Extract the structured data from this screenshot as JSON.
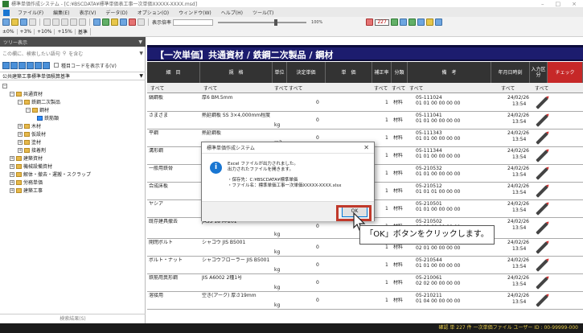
{
  "window": {
    "title": "標準単価作成システム - [C:¥BSCDATA¥標準単価表工事一次単価XXXXX-XXXX.msd]",
    "controls": [
      "–",
      "□",
      "×"
    ]
  },
  "menu": [
    "ファイル(F)",
    "編集(E)",
    "表示(V)",
    "データ(D)",
    "オプション(O)",
    "ウィンドウ(W)",
    "ヘルプ(H)",
    "ツール(T)"
  ],
  "toolbar": {
    "mode_label": "表示倍率",
    "zoom_label": "100%",
    "page_number": "227",
    "percent_buttons": [
      "±0%",
      "+3%",
      "+10%",
      "+15%",
      "基準"
    ]
  },
  "tree": {
    "header": "ツリー表示",
    "search_placeholder": "この欄に、検索したい語句",
    "search_mode": "を含む",
    "code_checkbox_label": "種目コードを表示する(V)",
    "root_title": "公共建築工事標準単価積算基準",
    "nodes": [
      {
        "label": "共通資材",
        "toggle": "⊟"
      },
      {
        "label": "鉄鋼二次製品",
        "toggle": "⊟"
      },
      {
        "label": "鋼材",
        "toggle": "⊟"
      },
      {
        "label": "鉄筋類",
        "toggle": ""
      },
      {
        "label": "木材",
        "toggle": "⊞"
      },
      {
        "label": "仮設材",
        "toggle": "⊞"
      },
      {
        "label": "塗材",
        "toggle": "⊞"
      },
      {
        "label": "接着剤",
        "toggle": "⊞"
      },
      {
        "label": "建築資材",
        "toggle": "⊞"
      },
      {
        "label": "機械設備資材",
        "toggle": "⊞"
      },
      {
        "label": "解体・撤去・運搬・スクラップ",
        "toggle": "⊞"
      },
      {
        "label": "労務単価",
        "toggle": "⊞"
      },
      {
        "label": "建築工事",
        "toggle": "⊞"
      }
    ],
    "bottom_search": "検索結果(S)"
  },
  "main": {
    "banner": "【一次単価】共通資材 / 鉄鋼二次製品 / 鋼材",
    "columns": [
      "細　目",
      "規　格",
      "単位",
      "決定単価",
      "単　価",
      "補正率",
      "分類",
      "備　考",
      "年月日時刻",
      "入力区分",
      "チェック"
    ],
    "filters": [
      "すべて",
      "すべて",
      "すべて",
      "すべて",
      "すべて",
      "すべて",
      "すべて",
      "すべて",
      "すべて"
    ],
    "rows": [
      {
        "name": "縞鋼板",
        "spec": "厚6 BM.5mm",
        "unit": "",
        "price": "0",
        "rate": "1",
        "cls": "材料",
        "code1": "05-111024",
        "code2": "01 01 00 00 00 00",
        "date": "24/02/26",
        "time": "13:54"
      },
      {
        "name": "さまざま",
        "spec": "熱延鋼板 SS 3×4,000mm程度",
        "unit": "kg",
        "price": "0",
        "rate": "1",
        "cls": "材料",
        "code1": "05-111041",
        "code2": "01 01 00 00 00 00",
        "date": "24/02/26",
        "time": "13:54"
      },
      {
        "name": "平鋼",
        "spec": "熱延鋼板",
        "unit": "m2",
        "price": "0",
        "rate": "1",
        "cls": "材料",
        "code1": "05-111343",
        "code2": "01 01 00 00 00 00",
        "date": "24/02/26",
        "time": "13:54"
      },
      {
        "name": "溝形鋼",
        "spec": "熱延鋼板",
        "unit": "",
        "price": "0",
        "rate": "1",
        "cls": "材料",
        "code1": "05-111344",
        "code2": "01 01 00 00 00 00",
        "date": "24/02/26",
        "time": "13:54"
      },
      {
        "name": "一般用鉄骨",
        "spec": "JIS G 3101",
        "unit": "",
        "price": "0",
        "rate": "1",
        "cls": "材料",
        "code1": "05-210532",
        "code2": "01 01 00 00 00 00",
        "date": "24/02/26",
        "time": "13:54"
      },
      {
        "name": "合成床板",
        "spec": "",
        "unit": "",
        "price": "0",
        "rate": "1",
        "cls": "材料",
        "code1": "05-210512",
        "code2": "01 01 01 00 00 00",
        "date": "24/02/26",
        "time": "13:54"
      },
      {
        "name": "ヤシア",
        "spec": "JASS 18",
        "unit": "",
        "price": "0",
        "rate": "1",
        "cls": "材料",
        "code1": "05-210501",
        "code2": "01 01 00 00 00 00",
        "date": "24/02/26",
        "time": "13:54"
      },
      {
        "name": "既存建具撤去",
        "spec": "JASS 18 M-201",
        "unit": "kg",
        "price": "0",
        "rate": "1",
        "cls": "材料",
        "code1": "05-210502",
        "code2": "01 01 00 00 00 00",
        "date": "24/02/26",
        "time": "13:54"
      },
      {
        "name": "開閉ボルト",
        "spec": "シャコウ JIS B5001",
        "unit": "kg",
        "price": "0",
        "rate": "1",
        "cls": "材料",
        "code1": "05-210534",
        "code2": "02 01 00 00 00 00",
        "date": "24/02/26",
        "time": "13:54"
      },
      {
        "name": "ボルト・ナット",
        "spec": "シャコウフローラー JIS B5001",
        "unit": "kg",
        "price": "0",
        "rate": "1",
        "cls": "材料",
        "code1": "05-210544",
        "code2": "01 01 00 00 00 00",
        "date": "24/02/26",
        "time": "13:54"
      },
      {
        "name": "鉄筋用異形鋼",
        "spec": "JIS A6002 2種1号",
        "unit": "kg",
        "price": "0",
        "rate": "1",
        "cls": "材料",
        "code1": "05-210061",
        "code2": "02 02 00 00 00 00",
        "date": "24/02/26",
        "time": "13:54"
      },
      {
        "name": "溶接用",
        "spec": "空き(アーク) 厚さ19mm",
        "unit": "kg",
        "price": "0",
        "rate": "1",
        "cls": "材料",
        "code1": "05-210211",
        "code2": "01 04 00 00 00 00",
        "date": "24/02/26",
        "time": "13:54"
      }
    ]
  },
  "dialog": {
    "title": "標準単価作成システム",
    "message_line1": "Excel ファイルが出力されました。",
    "message_line2": "出力されたファイルを開きます。",
    "detail_line1": "・保存先：C:¥BSCDATA¥標準単価",
    "detail_line2": "・ファイル名：標準単価工事一次単価XXXXX-XXXX.xlsx",
    "ok_label": "OK",
    "icon_glyph": "i"
  },
  "callout": "「OK」ボタンをクリックします。",
  "status": "確認  単  227 件  一次単価ファイル  ユーザー ID : 00-99999-000",
  "colors": {
    "banner_bg": "#1c1c6e",
    "accent_red": "#c0392b",
    "dialog_icon": "#1976d2",
    "status_text": "#e3c84a"
  }
}
